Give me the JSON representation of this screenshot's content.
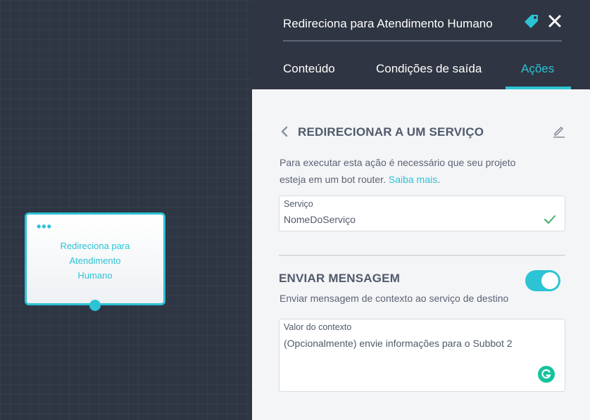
{
  "canvas": {
    "node": {
      "menu": "•••",
      "title_lines": [
        "Redireciona para",
        "Atendimento",
        "Humano"
      ]
    }
  },
  "header": {
    "title": "Redireciona para Atendimento Humano",
    "tabs": [
      {
        "label": "Conteúdo",
        "active": false
      },
      {
        "label": "Condições de saída",
        "active": false
      },
      {
        "label": "Ações",
        "active": true
      }
    ]
  },
  "action": {
    "title": "REDIRECIONAR A UM SERVIÇO",
    "description_line1": "Para executar esta ação é necessário que seu projeto",
    "description_line2": "esteja em um bot router.",
    "link": "Saiba mais",
    "link_suffix": ".",
    "service_field": {
      "label": "Serviço",
      "value": "NomeDoServiço"
    }
  },
  "send_message": {
    "title": "ENVIAR MENSAGEM",
    "enabled": true,
    "description": "Enviar mensagem de contexto ao serviço de destino",
    "context_field": {
      "label": "Valor do contexto",
      "placeholder": "(Opcionalmente) envie informações para o Subbot 2"
    }
  },
  "colors": {
    "accent": "#2cc3d5",
    "dark_bg": "#2f3542",
    "panel_bg": "#f4f5f7",
    "text": "#505a6b",
    "success": "#3fae6a",
    "grammarly": "#15c39a"
  }
}
